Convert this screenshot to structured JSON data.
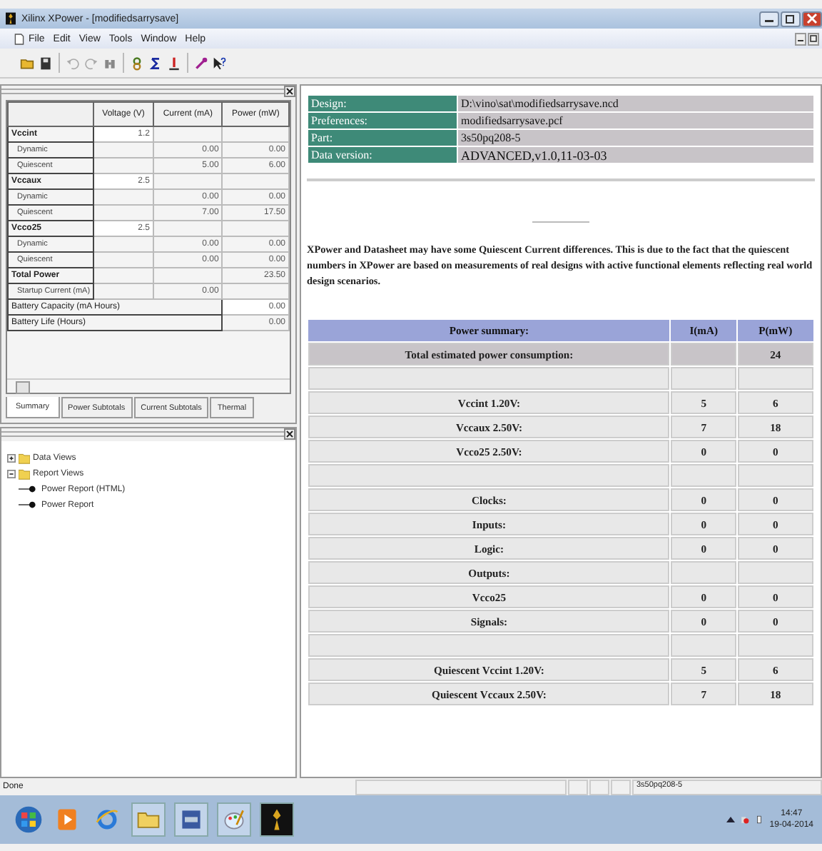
{
  "window": {
    "title": "Xilinx XPower - [modifiedsarrysave]"
  },
  "menu": [
    "File",
    "Edit",
    "View",
    "Tools",
    "Window",
    "Help"
  ],
  "grid": {
    "columns": [
      "Voltage (V)",
      "Current (mA)",
      "Power (mW)"
    ],
    "rows": [
      {
        "kind": "group",
        "label": "Vccint",
        "voltage": "1.2"
      },
      {
        "kind": "sub",
        "label": "Dynamic",
        "current": "0.00",
        "power": "0.00"
      },
      {
        "kind": "sub",
        "label": "Quiescent",
        "current": "5.00",
        "power": "6.00"
      },
      {
        "kind": "group",
        "label": "Vccaux",
        "voltage": "2.5"
      },
      {
        "kind": "sub",
        "label": "Dynamic",
        "current": "0.00",
        "power": "0.00"
      },
      {
        "kind": "sub",
        "label": "Quiescent",
        "current": "7.00",
        "power": "17.50"
      },
      {
        "kind": "group",
        "label": "Vcco25",
        "voltage": "2.5"
      },
      {
        "kind": "sub",
        "label": "Dynamic",
        "current": "0.00",
        "power": "0.00"
      },
      {
        "kind": "sub",
        "label": "Quiescent",
        "current": "0.00",
        "power": "0.00"
      },
      {
        "kind": "total",
        "label": "Total Power",
        "power": "23.50"
      },
      {
        "kind": "sub",
        "label": "Startup Current (mA)",
        "current": "0.00"
      },
      {
        "kind": "wide",
        "label": "Battery Capacity (mA Hours)",
        "power": "0.00"
      },
      {
        "kind": "wide",
        "label": "Battery Life (Hours)",
        "power": "0.00"
      }
    ]
  },
  "tabs": [
    {
      "label": "Summary",
      "selected": true
    },
    {
      "label": "Power Subtotals",
      "selected": false
    },
    {
      "label": "Current Subtotals",
      "selected": false
    },
    {
      "label": "Thermal",
      "selected": false
    }
  ],
  "tree": [
    {
      "label": "Data Views",
      "expanded": false
    },
    {
      "label": "Report Views",
      "expanded": true,
      "children": [
        {
          "label": "Power Report (HTML)"
        },
        {
          "label": "Power Report"
        }
      ]
    }
  ],
  "info": [
    {
      "label": "Design:",
      "value": "D:\\vino\\sat\\modifiedsarrysave.ncd"
    },
    {
      "label": "Preferences:",
      "value": "modifiedsarrysave.pcf"
    },
    {
      "label": "Part:",
      "value": "3s50pq208-5"
    },
    {
      "label": "Data version:",
      "value": "ADVANCED,v1.0,11-03-03"
    }
  ],
  "note": "XPower and Datasheet may have some Quiescent Current differences. This is due to the fact that the quiescent numbers in XPower are based on measurements of real designs with active functional elements reflecting real world design scenarios.",
  "summary": {
    "columns": [
      "Power summary:",
      "I(mA)",
      "P(mW)"
    ],
    "rows": [
      {
        "kind": "total",
        "label": "Total estimated power consumption:",
        "current": "",
        "power": "24"
      },
      {
        "kind": "blank"
      },
      {
        "kind": "row",
        "label": "Vccint 1.20V:",
        "current": "5",
        "power": "6"
      },
      {
        "kind": "row",
        "label": "Vccaux 2.50V:",
        "current": "7",
        "power": "18"
      },
      {
        "kind": "row",
        "label": "Vcco25 2.50V:",
        "current": "0",
        "power": "0"
      },
      {
        "kind": "blank"
      },
      {
        "kind": "row",
        "label": "Clocks:",
        "current": "0",
        "power": "0"
      },
      {
        "kind": "row",
        "label": "Inputs:",
        "current": "0",
        "power": "0"
      },
      {
        "kind": "row",
        "label": "Logic:",
        "current": "0",
        "power": "0"
      },
      {
        "kind": "row",
        "label": "Outputs:",
        "current": "",
        "power": ""
      },
      {
        "kind": "row",
        "label": "Vcco25",
        "current": "0",
        "power": "0"
      },
      {
        "kind": "row",
        "label": "Signals:",
        "current": "0",
        "power": "0"
      },
      {
        "kind": "blank"
      },
      {
        "kind": "row",
        "label": "Quiescent Vccint 1.20V:",
        "current": "5",
        "power": "6"
      },
      {
        "kind": "row",
        "label": "Quiescent Vccaux 2.50V:",
        "current": "7",
        "power": "18"
      }
    ]
  },
  "status": {
    "text": "Done",
    "part": "3s50pq208-5"
  },
  "clock": {
    "time": "14:47",
    "date": "19-04-2014"
  }
}
